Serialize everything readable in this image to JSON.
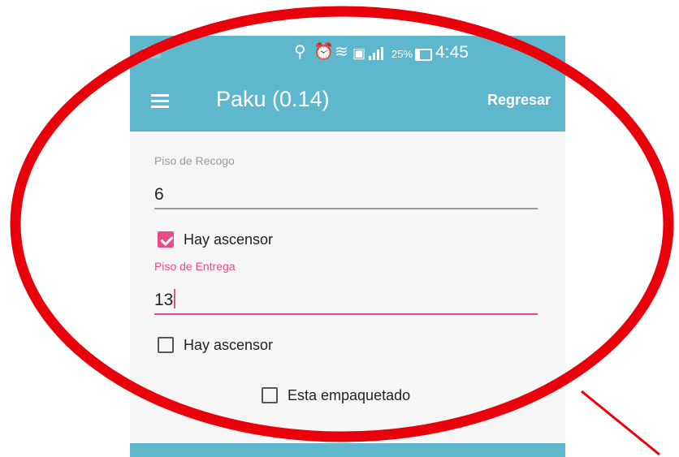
{
  "status_bar": {
    "battery_percent": "25%",
    "battery_level": 0.25,
    "time": "4:45",
    "icons": [
      "location-icon",
      "alarm-icon",
      "wifi-icon",
      "sim-icon",
      "signal-icon",
      "battery-icon"
    ]
  },
  "app_bar": {
    "menu_icon": "menu-icon",
    "title": "Paku (0.14)",
    "back_label": "Regresar"
  },
  "form": {
    "pickup_floor": {
      "label": "Piso de Recogo",
      "value": "6"
    },
    "pickup_elevator": {
      "label": "Hay ascensor",
      "checked": true
    },
    "delivery_floor": {
      "label": "Piso de Entrega",
      "value": "13"
    },
    "delivery_elevator": {
      "label": "Hay ascensor",
      "checked": false
    },
    "packaged": {
      "label": "Esta empaquetado",
      "checked": false
    }
  },
  "colors": {
    "primary": "#5eb7cc",
    "accent": "#e94a88",
    "annotation": "#e8000b"
  }
}
